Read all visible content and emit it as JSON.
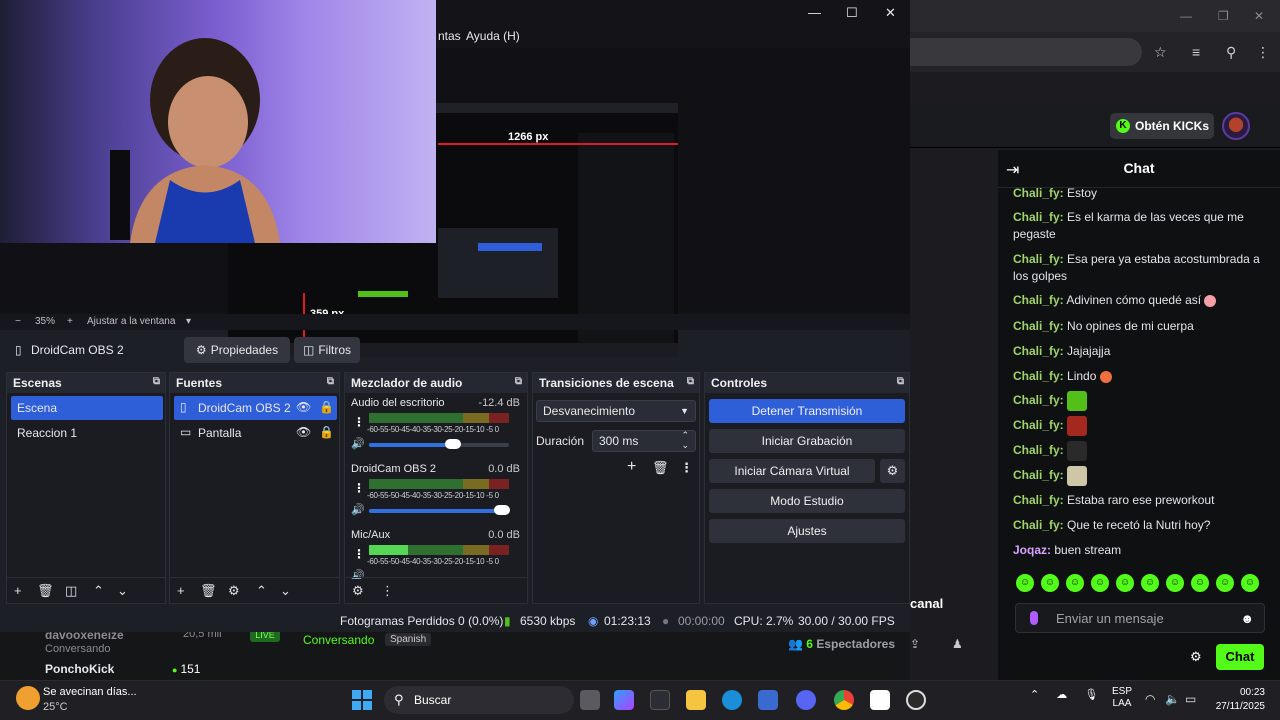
{
  "obs": {
    "menu": {
      "tools_partial": "ntas",
      "help": "Ayuda (H)"
    },
    "preview": {
      "width_guide": "1266 px",
      "height_guide": "359 px"
    },
    "zoom": {
      "value": "35%",
      "fit": "Ajustar a la ventana"
    },
    "selected_source": "DroidCam OBS 2",
    "props_bar": {
      "properties": "Propiedades",
      "filters": "Filtros"
    },
    "scenes": {
      "title": "Escenas",
      "items": [
        "Escena",
        "Reaccion 1"
      ],
      "selected": 0
    },
    "sources": {
      "title": "Fuentes",
      "items": [
        "DroidCam OBS 2",
        "Pantalla"
      ],
      "selected": 0
    },
    "mixer": {
      "title": "Mezclador de audio",
      "channels": [
        {
          "name": "Audio del escritorio",
          "db": "-12.4 dB",
          "level": 0.0,
          "volume": 0.6
        },
        {
          "name": "DroidCam OBS 2",
          "db": "0.0 dB",
          "level": 0.0,
          "volume": 0.95
        },
        {
          "name": "Mic/Aux",
          "db": "0.0 dB",
          "level": 0.28,
          "volume": 0.95
        }
      ],
      "ticks": "-60-55-50-45-40-35-30-25-20-15-10 -5  0"
    },
    "transitions": {
      "title": "Transiciones de escena",
      "selected": "Desvanecimiento",
      "duration_label": "Duración",
      "duration": "300 ms"
    },
    "controls": {
      "title": "Controles",
      "buttons": [
        "Detener Transmisión",
        "Iniciar Grabación",
        "Iniciar Cámara Virtual",
        "Modo Estudio",
        "Ajustes"
      ]
    },
    "status": {
      "dropped": "Fotogramas Perdidos 0 (0.0%)",
      "bitrate": "6530 kbps",
      "stream_time": "01:23:13",
      "rec_time": "00:00:00",
      "cpu": "CPU: 2.7%",
      "fps": "30.00 / 30.00 FPS"
    }
  },
  "browser": {
    "kicks_button": "Obtén KICKs",
    "chat_title": "Chat",
    "messages": [
      {
        "user": "Chali_fy:",
        "text": "Estoy"
      },
      {
        "user": "Chali_fy:",
        "text": "Es el karma de las veces que me pegaste"
      },
      {
        "user": "Chali_fy:",
        "text": "Esa pera ya estaba acostumbrada a los golpes"
      },
      {
        "user": "Chali_fy:",
        "text": "Adivinen cómo quedé así"
      },
      {
        "user": "Chali_fy:",
        "text": "No opines de mi cuerpa"
      },
      {
        "user": "Chali_fy:",
        "text": "Jajajajja"
      },
      {
        "user": "Chali_fy:",
        "text": "Lindo"
      },
      {
        "user": "Chali_fy:",
        "text": ""
      },
      {
        "user": "Chali_fy:",
        "text": ""
      },
      {
        "user": "Chali_fy:",
        "text": ""
      },
      {
        "user": "Chali_fy:",
        "text": ""
      },
      {
        "user": "Chali_fy:",
        "text": "Estaba raro ese preworkout"
      },
      {
        "user": "Chali_fy:",
        "text": "Que te recetó la Nutri hoy?"
      },
      {
        "user": "Joqaz:",
        "text": "buen stream"
      }
    ],
    "input_placeholder": "Enviar un mensaje",
    "send": "Chat",
    "spectators_count": "6",
    "spectators_label": "Espectadores",
    "canal": "canal"
  },
  "stream_strip": {
    "user1": "davooxeneize",
    "user1_status": "Conversando",
    "live": "LIVE",
    "category": "Conversando",
    "language": "Spanish",
    "user2": "PonchoKick",
    "viewers2": "151",
    "viewers1": "20,5 mil"
  },
  "taskbar": {
    "weather": "Se avecinan días...",
    "temp": "25°C",
    "search": "Buscar",
    "lang1": "ESP",
    "lang2": "LAA",
    "time": "00:23",
    "date": "27/11/2025"
  }
}
